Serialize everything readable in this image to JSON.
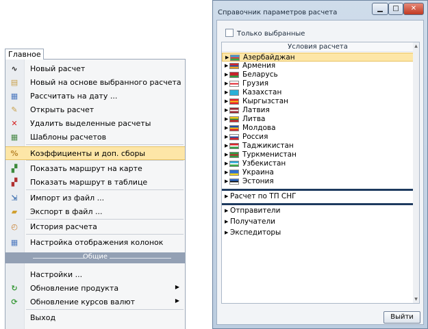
{
  "menu": {
    "tab_label": "Главное",
    "group_label": "Общие",
    "items": [
      {
        "label": "Новый расчет",
        "icon": "route-icon",
        "color": "#2b2b2b",
        "glyph": "∿"
      },
      {
        "label": "Новый на основе выбранного расчета",
        "icon": "document-copy-icon",
        "color": "#c8a04a",
        "glyph": "▤"
      },
      {
        "label": "Рассчитать на дату ...",
        "icon": "calendar-calc-icon",
        "color": "#4f7ac0",
        "glyph": "▦"
      },
      {
        "label": "Открыть расчет",
        "icon": "open-document-icon",
        "color": "#c8a04a",
        "glyph": "✎"
      },
      {
        "label": "Удалить выделенные расчеты",
        "icon": "delete-icon",
        "color": "#d42020",
        "glyph": "✕"
      },
      {
        "label": "Шаблоны расчетов",
        "icon": "template-grid-icon",
        "color": "#4a8a4a",
        "glyph": "▦"
      },
      {
        "label": "Коэффициенты и доп. сборы",
        "icon": "percent-icon",
        "color": "#b8862c",
        "glyph": "%"
      },
      {
        "label": "Показать маршрут на карте",
        "icon": "map-route-icon",
        "color": "#3c8a3c",
        "glyph": "▞"
      },
      {
        "label": "Показать маршрут в таблице",
        "icon": "table-route-icon",
        "color": "#b03030",
        "glyph": "▞"
      },
      {
        "label": "Импорт из файл ...",
        "icon": "import-icon",
        "color": "#3c6fb0",
        "glyph": "⇲"
      },
      {
        "label": "Экспорт в файл ...",
        "icon": "export-folder-icon",
        "color": "#d0a030",
        "glyph": "▰"
      },
      {
        "label": "История расчета",
        "icon": "history-icon",
        "color": "#c88030",
        "glyph": "◴"
      },
      {
        "label": "Настройка отображения колонок",
        "icon": "columns-settings-icon",
        "color": "#4f7ac0",
        "glyph": "▦"
      },
      {
        "label": "Настройки ...",
        "icon": "",
        "color": "#000000",
        "glyph": ""
      },
      {
        "label": "Обновление продукта",
        "icon": "update-product-icon",
        "color": "#3a9a3a",
        "glyph": "↻"
      },
      {
        "label": "Обновление курсов валют",
        "icon": "currency-update-icon",
        "color": "#3a9a3a",
        "glyph": "⟳"
      },
      {
        "label": "Выход",
        "icon": "",
        "color": "#000000",
        "glyph": ""
      }
    ]
  },
  "dialog": {
    "title": "Справочник параметров расчета",
    "close_glyph": "✕",
    "only_selected_label": "Только выбранные",
    "tree_header": "Условия расчета",
    "countries": [
      {
        "name": "Азербайджан",
        "colors": [
          "#3f9fd8",
          "#e23a3a",
          "#3aa845"
        ]
      },
      {
        "name": "Армения",
        "colors": [
          "#d9242a",
          "#1f4fa8",
          "#f2a21c"
        ]
      },
      {
        "name": "Беларусь",
        "colors": [
          "#c8232c",
          "#c8232c",
          "#2f9e44"
        ]
      },
      {
        "name": "Грузия",
        "colors": [
          "#ffffff",
          "#e0202a",
          "#ffffff"
        ]
      },
      {
        "name": "Казахстан",
        "colors": [
          "#28b0d8",
          "#28b0d8",
          "#28b0d8"
        ]
      },
      {
        "name": "Кыргызстан",
        "colors": [
          "#e8202a",
          "#f2c81c",
          "#e8202a"
        ]
      },
      {
        "name": "Латвия",
        "colors": [
          "#9a2430",
          "#ffffff",
          "#9a2430"
        ]
      },
      {
        "name": "Литва",
        "colors": [
          "#f2c81c",
          "#2f8a44",
          "#c8232c"
        ]
      },
      {
        "name": "Молдова",
        "colors": [
          "#1f4fa8",
          "#f2c81c",
          "#d9242a"
        ]
      },
      {
        "name": "Россия",
        "colors": [
          "#ffffff",
          "#1f4fa8",
          "#d9242a"
        ]
      },
      {
        "name": "Таджикистан",
        "colors": [
          "#d9242a",
          "#ffffff",
          "#2f9e44"
        ]
      },
      {
        "name": "Туркменистан",
        "colors": [
          "#2f9e44",
          "#c8232c",
          "#2f9e44"
        ]
      },
      {
        "name": "Узбекистан",
        "colors": [
          "#28a8d8",
          "#ffffff",
          "#3aa845"
        ]
      },
      {
        "name": "Украина",
        "colors": [
          "#2f6fd0",
          "#2f6fd0",
          "#f2d21c"
        ]
      },
      {
        "name": "Эстония",
        "colors": [
          "#2f6fd0",
          "#111111",
          "#ffffff"
        ]
      }
    ],
    "cis_item": "Расчет по ТП СНГ",
    "other_items": [
      "Отправители",
      "Получатели",
      "Экспедиторы"
    ],
    "exit_label": "Выйти",
    "colors": {
      "highlight": "#fde6a7",
      "divider": "#1d3a5f"
    }
  }
}
